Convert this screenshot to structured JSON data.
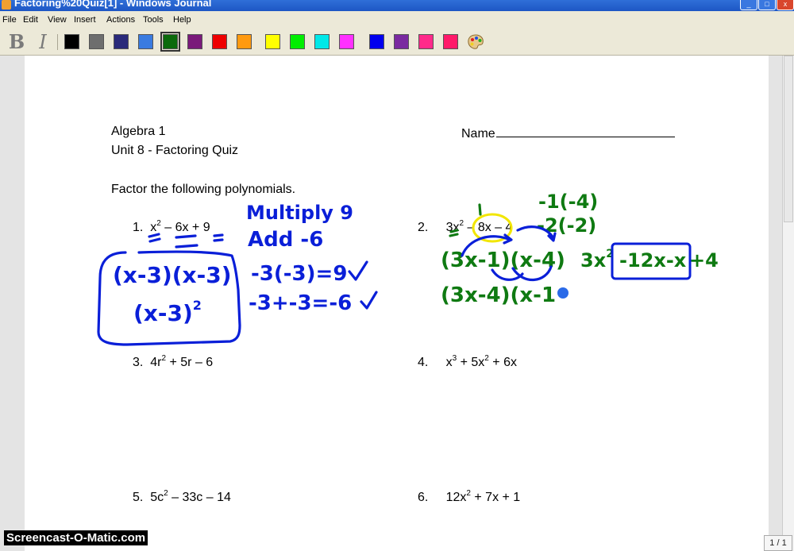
{
  "window": {
    "title": "Factoring%20Quiz[1] - Windows Journal",
    "controls": {
      "minimize": "_",
      "maximize": "□",
      "close": "x"
    }
  },
  "menu": {
    "items": [
      "File",
      "Edit",
      "View",
      "Insert",
      "Actions",
      "Tools",
      "Help"
    ]
  },
  "toolbar": {
    "bold_label": "B",
    "italic_label": "I",
    "pen_colors": [
      "#000000",
      "#6e6e6e",
      "#2a2a7a",
      "#3a7be0",
      "#0b6a0b",
      "#7a1a7a",
      "#ee0000",
      "#ff9a10",
      "#ffff00",
      "#00ee00",
      "#00e8e8",
      "#ff30ff",
      "#0000ee",
      "#7a2aa0",
      "#ff2a8a",
      "#ff1a6a"
    ],
    "selected_color": "#0b6a0b",
    "palette_icon": "palette-icon"
  },
  "document": {
    "course": "Algebra 1",
    "unit": "Unit 8 - Factoring Quiz",
    "name_label": "Name",
    "instructions": "Factor the following polynomials.",
    "problems": [
      {
        "num": "1.",
        "parts": [
          "x",
          "2",
          " – 6x + 9"
        ]
      },
      {
        "num": "2.",
        "parts": [
          "3x",
          "2",
          " – 8x – 4"
        ]
      },
      {
        "num": "3.",
        "parts": [
          "4r",
          "2",
          " + 5r – 6"
        ]
      },
      {
        "num": "4.",
        "parts": [
          "x",
          "3",
          " + 5x",
          "2",
          " + 6x"
        ]
      },
      {
        "num": "5.",
        "parts": [
          "5c",
          "2",
          " – 33c – 14"
        ]
      },
      {
        "num": "6.",
        "parts": [
          "12x",
          "2",
          " + 7x + 1"
        ]
      }
    ]
  },
  "ink": {
    "blue": {
      "multiply": "Multiply 9",
      "add": "Add  -6",
      "check1_lhs": "-3(-3)=9",
      "check2_lhs": "-3+-3=-6",
      "answer1": "(x-3)(x-3)",
      "answer2": "(x-3)",
      "answer2_exp": "2"
    },
    "green": {
      "pair1": "-1(-4)",
      "pair2": "-2(-2)",
      "factored_a": "(3x-1)(x-4)",
      "expanded_a": "3x",
      "expanded_a_exp": "2",
      "expanded_b": "-12x-x",
      "expanded_c": "+4",
      "factored_b": "(3x-4)(x-1"
    }
  },
  "status": {
    "watermark": "Screencast-O-Matic.com",
    "page_count": "1 / 1"
  }
}
